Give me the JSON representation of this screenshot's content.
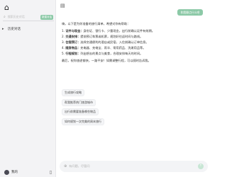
{
  "sidebar": {
    "logo_icon": "logo-icon",
    "search": {
      "placeholder": "搜索历史对话",
      "button_label": "新建对话"
    },
    "items": [
      {
        "icon": "history-icon",
        "label": "历史对话"
      }
    ],
    "footer": {
      "username": "我的",
      "phone_icon": "phone-icon"
    }
  },
  "main": {
    "toggle_icon": "sidebar-toggle-icon",
    "new_chat_label": "和我聊点什么吧",
    "answer": {
      "intro": "嗨，以下是为你准备的旅行清单，希望对你有帮助：",
      "items": [
        {
          "num": "1.",
          "bold": "证件与现金：",
          "text": "身份证、银行卡、少量现金，出行前确认证件有效期。"
        },
        {
          "num": "2.",
          "bold": "交通安排：",
          "text": "提前预订车票或机票，规划好往返时间与路线。"
        },
        {
          "num": "3.",
          "bold": "住宿预订：",
          "text": "选择交通便利的酒店或民宿，入住前确认订单信息。"
        },
        {
          "num": "4.",
          "bold": "随身物品：",
          "text": "充电器、充电宝、雨伞、常用药品、洗漱用品等。"
        },
        {
          "num": "5.",
          "bold": "行程规划：",
          "text": "列出想去的景点与美食，合理安排每天的时间。"
        }
      ],
      "summary": "最后，祝你旅途愉快，一路平安！如需调整行程，可以随时告诉我。"
    },
    "suggestions": [
      "生成旅行攻略",
      "帮我推荐热门旅游城市",
      "出行前需要准备哪些物品",
      "如何规划一次完美的周末旅行"
    ],
    "input": {
      "placeholder": "有问题，尽管问"
    }
  }
}
